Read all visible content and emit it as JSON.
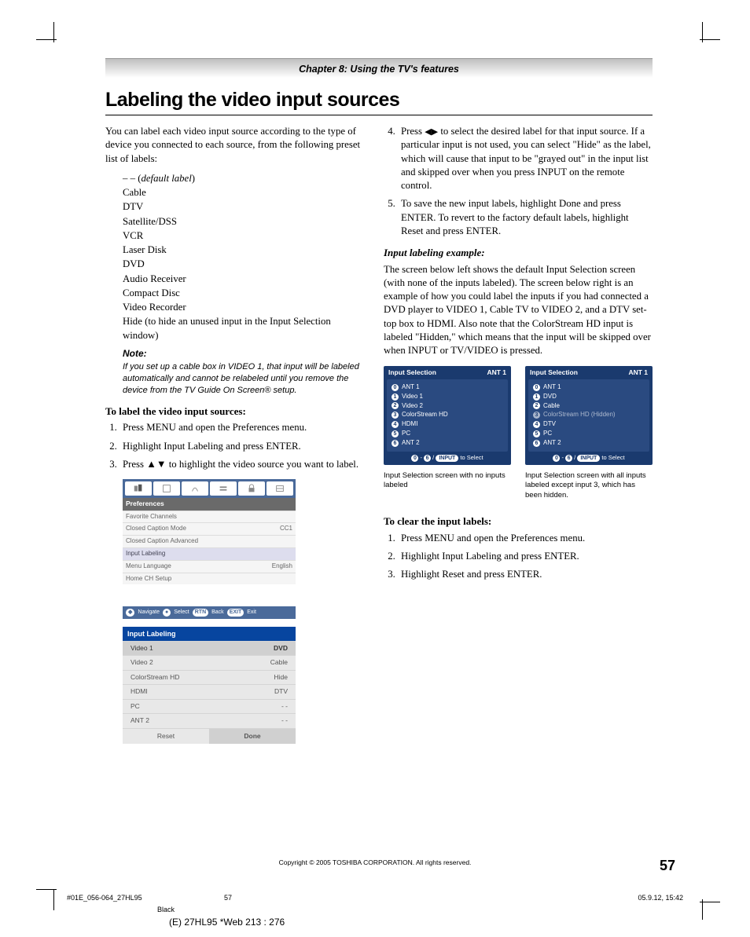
{
  "chapter": "Chapter 8: Using the TV's features",
  "title": "Labeling the video input sources",
  "intro": "You can label each video input source according to the type of device you connected to each source, from the following preset list of labels:",
  "labels_line1": "– – (",
  "labels_default": "default label",
  "labels_line1b": ")",
  "labels": [
    "Cable",
    "DTV",
    "Satellite/DSS",
    "VCR",
    "Laser Disk",
    "DVD",
    "Audio Receiver",
    "Compact Disc",
    "Video Recorder",
    "Hide (to hide an unused input in the Input Selection window)"
  ],
  "note_head": "Note:",
  "note_body": "If you set up a cable box in VIDEO 1, that input will be labeled automatically and cannot be relabeled until you remove the device from the TV Guide On Screen® setup.",
  "to_label_head": "To label the video input sources:",
  "steps_label": [
    "Press MENU and open the Preferences menu.",
    "Highlight Input Labeling and press ENTER.",
    "Press ▲▼ to highlight the video source you want to label."
  ],
  "step4_pre": "Press ",
  "step4_arrows": "◀▶",
  "step4_post": " to select the desired label for that input source. If a particular input is not used, you can select \"Hide\" as the label, which will cause that input to be \"grayed out\" in the input list and skipped over when you press INPUT on the remote control.",
  "step5": "To save the new input labels, highlight Done and press ENTER.  To revert to the factory default labels, highlight Reset and press ENTER.",
  "example_head": "Input labeling example:",
  "example_body": "The screen below left shows the default Input Selection screen (with none of the inputs labeled). The screen below right is an example of how you could label the inputs if you had connected a DVD player to VIDEO 1, Cable TV to VIDEO 2, and a DTV set-top box to HDMI. Also note that the ColorStream HD input is labeled \"Hidden,\" which means that the input will be skipped over when INPUT or TV/VIDEO is pressed.",
  "osd1": {
    "title": "Input Selection",
    "ant": "ANT 1",
    "rows": [
      "ANT 1",
      "Video 1",
      "Video 2",
      "ColorStream HD",
      "HDMI",
      "PC",
      "ANT 2"
    ],
    "foot": " to Select",
    "caption": "Input Selection screen with no inputs labeled"
  },
  "osd2": {
    "title": "Input Selection",
    "ant": "ANT 1",
    "rows": [
      "ANT 1",
      "DVD",
      "Cable",
      "ColorStream HD (Hidden)",
      "DTV",
      "PC",
      "ANT 2"
    ],
    "foot": " to Select",
    "caption": "Input Selection screen with all inputs labeled except input 3, which has been hidden."
  },
  "prefs": {
    "title": "Preferences",
    "rows": [
      {
        "l": "Favorite Channels",
        "r": ""
      },
      {
        "l": "Closed Caption Mode",
        "r": "CC1"
      },
      {
        "l": "Closed Caption Advanced",
        "r": ""
      },
      {
        "l": "Input Labeling",
        "r": "",
        "sel": true
      },
      {
        "l": "Menu Language",
        "r": "English"
      },
      {
        "l": "Home CH Setup",
        "r": ""
      }
    ],
    "nav": "Navigate",
    "sel": "Select",
    "back": "Back",
    "exit": "Exit"
  },
  "il": {
    "title": "Input Labeling",
    "rows": [
      {
        "l": "Video 1",
        "r": "DVD",
        "sel": true
      },
      {
        "l": "Video 2",
        "r": "Cable"
      },
      {
        "l": "ColorStream HD",
        "r": "Hide"
      },
      {
        "l": "HDMI",
        "r": "DTV"
      },
      {
        "l": "PC",
        "r": "- -"
      },
      {
        "l": "ANT 2",
        "r": "- -"
      }
    ],
    "reset": "Reset",
    "done": "Done"
  },
  "clear_head": "To clear the input labels:",
  "steps_clear": [
    "Press MENU and open the Preferences menu.",
    "Highlight Input Labeling and press ENTER.",
    "Highlight Reset and press ENTER."
  ],
  "copyright": "Copyright © 2005 TOSHIBA CORPORATION. All rights reserved.",
  "pagenum": "57",
  "meta_left": "#01E_056-064_27HL95",
  "meta_mid": "57",
  "meta_right": "05.9.12, 15:42",
  "meta_black": "Black",
  "meta_web": "(E) 27HL95 *Web 213 : 276"
}
